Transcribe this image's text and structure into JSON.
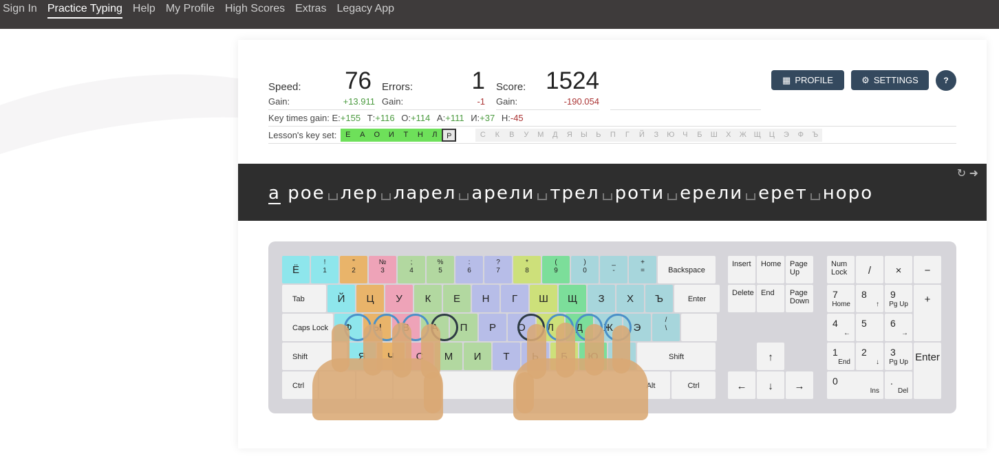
{
  "nav": [
    "Sign In",
    "Practice Typing",
    "Help",
    "My Profile",
    "High Scores",
    "Extras",
    "Legacy App"
  ],
  "stats": {
    "speed_label": "Speed:",
    "speed_value": "76",
    "errors_label": "Errors:",
    "errors_value": "1",
    "score_label": "Score:",
    "score_value": "1524",
    "gain_label": "Gain:",
    "speed_gain": "+13.911",
    "errors_gain": "-1",
    "score_gain": "-190.054"
  },
  "key_times": {
    "label": "Key times gain:",
    "items": [
      {
        "k": "Е:",
        "v": "+155",
        "pos": true
      },
      {
        "k": "Т:",
        "v": "+116",
        "pos": true
      },
      {
        "k": "О:",
        "v": "+114",
        "pos": true
      },
      {
        "k": "А:",
        "v": "+111",
        "pos": true
      },
      {
        "k": "И:",
        "v": "+37",
        "pos": true
      },
      {
        "k": "Н:",
        "v": "-45",
        "pos": false
      }
    ]
  },
  "lesson_keyset": {
    "label": "Lesson's key set:",
    "active": [
      "Е",
      "А",
      "О",
      "И",
      "Т",
      "Н",
      "Л"
    ],
    "current": "Р",
    "inactive": [
      "С",
      "К",
      "В",
      "У",
      "М",
      "Д",
      "Я",
      "Ы",
      "Ь",
      "П",
      "Г",
      "Й",
      "З",
      "Ю",
      "Ч",
      "Б",
      "Ш",
      "Х",
      "Ж",
      "Щ",
      "Ц",
      "Э",
      "Ф",
      "Ъ"
    ]
  },
  "buttons": {
    "profile": "PROFILE",
    "settings": "SETTINGS",
    "help": "?"
  },
  "typing": {
    "first_char": "а",
    "words": [
      "роe",
      "лер",
      "ларел",
      "арели",
      "трел",
      "роти",
      "ерели",
      "ерет",
      "норо"
    ]
  },
  "keyboard": {
    "row1": [
      {
        "t": "Ё",
        "b": "",
        "c": "#8ee6ec"
      },
      {
        "t": "!",
        "b": "1",
        "c": "#8ee6ec"
      },
      {
        "t": "\"",
        "b": "2",
        "c": "#e9b46a"
      },
      {
        "t": "№",
        "b": "3",
        "c": "#eea3b8"
      },
      {
        "t": ";",
        "b": "4",
        "c": "#b2d8a0"
      },
      {
        "t": "%",
        "b": "5",
        "c": "#b2d8a0"
      },
      {
        "t": ":",
        "b": "6",
        "c": "#b7bde8"
      },
      {
        "t": "?",
        "b": "7",
        "c": "#b7bde8"
      },
      {
        "t": "*",
        "b": "8",
        "c": "#cde07a"
      },
      {
        "t": "(",
        "b": "9",
        "c": "#7cde9a"
      },
      {
        "t": ")",
        "b": "0",
        "c": "#a7d6dc"
      },
      {
        "t": "_",
        "b": "-",
        "c": "#a7d6dc"
      },
      {
        "t": "+",
        "b": "=",
        "c": "#a7d6dc"
      }
    ],
    "backspace": "Backspace",
    "tab": "Tab",
    "row2": [
      {
        "k": "Й",
        "c": "#8ee6ec"
      },
      {
        "k": "Ц",
        "c": "#e9b46a"
      },
      {
        "k": "У",
        "c": "#eea3b8"
      },
      {
        "k": "К",
        "c": "#b2d8a0"
      },
      {
        "k": "Е",
        "c": "#b2d8a0"
      },
      {
        "k": "Н",
        "c": "#b7bde8"
      },
      {
        "k": "Г",
        "c": "#b7bde8"
      },
      {
        "k": "Ш",
        "c": "#cde07a"
      },
      {
        "k": "Щ",
        "c": "#7cde9a"
      },
      {
        "k": "З",
        "c": "#a7d6dc"
      },
      {
        "k": "Х",
        "c": "#a7d6dc"
      },
      {
        "k": "Ъ",
        "c": "#a7d6dc"
      }
    ],
    "enter": "Enter",
    "caps": "Caps Lock",
    "row3": [
      {
        "k": "Ф",
        "c": "#8ee6ec"
      },
      {
        "k": "Ы",
        "c": "#e9b46a"
      },
      {
        "k": "В",
        "c": "#eea3b8"
      },
      {
        "k": "А",
        "c": "#b2d8a0"
      },
      {
        "k": "П",
        "c": "#b2d8a0"
      },
      {
        "k": "Р",
        "c": "#b7bde8"
      },
      {
        "k": "О",
        "c": "#b7bde8"
      },
      {
        "k": "Л",
        "c": "#cde07a"
      },
      {
        "k": "Д",
        "c": "#7cde9a"
      },
      {
        "k": "Ж",
        "c": "#a7d6dc"
      },
      {
        "k": "Э",
        "c": "#a7d6dc"
      }
    ],
    "backslash": {
      "t": "/",
      "b": "\\"
    },
    "shift": "Shift",
    "row4": [
      {
        "k": "Я",
        "c": "#8ee6ec"
      },
      {
        "k": "Ч",
        "c": "#e9b46a"
      },
      {
        "k": "С",
        "c": "#eea3b8"
      },
      {
        "k": "М",
        "c": "#b2d8a0"
      },
      {
        "k": "И",
        "c": "#b2d8a0"
      },
      {
        "k": "Т",
        "c": "#b7bde8"
      },
      {
        "k": "Ь",
        "c": "#b7bde8"
      },
      {
        "k": "Б",
        "c": "#cde07a"
      },
      {
        "k": "Ю",
        "c": "#7cde9a"
      },
      {
        "k": ".",
        "c": "#a7d6dc"
      }
    ],
    "ctrl": "Ctrl",
    "alt": "Alt",
    "nav_keys": {
      "insert": "Insert",
      "home": "Home",
      "page_up": "Page Up",
      "delete": "Delete",
      "end": "End",
      "page_down": "Page Down"
    },
    "arrows": {
      "up": "↑",
      "left": "←",
      "down": "↓",
      "right": "→"
    },
    "numpad": {
      "numlock": "Num Lock",
      "div": "/",
      "mul": "×",
      "minus": "−",
      "plus": "+",
      "enter": "Enter",
      "n7": "7",
      "n7s": "Home",
      "n8": "8",
      "n8s": "↑",
      "n9": "9",
      "n9s": "Pg Up",
      "n4": "4",
      "n4s": "←",
      "n5": "5",
      "n6": "6",
      "n6s": "→",
      "n1": "1",
      "n1s": "End",
      "n2": "2",
      "n2s": "↓",
      "n3": "3",
      "n3s": "Pg Up",
      "n0": "0",
      "n0s": "Ins",
      "dot": ".",
      "dots": "Del"
    }
  },
  "colors": {
    "button": "#34495e",
    "active_key": "#6ee05a",
    "positive": "#4a9a3e",
    "negative": "#a33"
  }
}
